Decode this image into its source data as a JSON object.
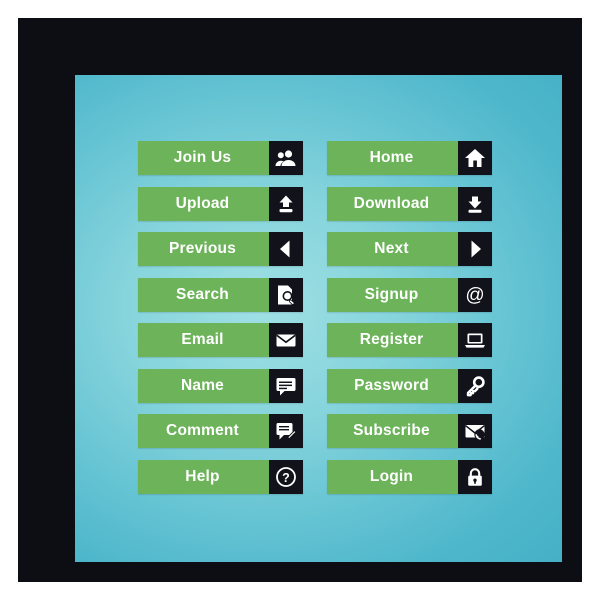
{
  "theme": {
    "frame_color": "#0c0e14",
    "panel_gradient_center": "#9fe0e4",
    "panel_gradient_edge": "#45b0c6",
    "button_green": "#6cb35a",
    "icon_block_dark": "#12131a",
    "label_text_color": "#ffffff"
  },
  "buttons": {
    "left_column": [
      {
        "label": "Join Us",
        "icon": "user-group-icon"
      },
      {
        "label": "Upload",
        "icon": "upload-arrow-icon"
      },
      {
        "label": "Previous",
        "icon": "arrow-left-icon"
      },
      {
        "label": "Search",
        "icon": "magnifier-document-icon"
      },
      {
        "label": "Email",
        "icon": "envelope-icon"
      },
      {
        "label": "Name",
        "icon": "speech-bubble-icon"
      },
      {
        "label": "Comment",
        "icon": "comment-pencil-icon"
      },
      {
        "label": "Help",
        "icon": "question-mark-icon"
      }
    ],
    "right_column": [
      {
        "label": "Home",
        "icon": "house-icon"
      },
      {
        "label": "Download",
        "icon": "download-arrow-icon"
      },
      {
        "label": "Next",
        "icon": "arrow-right-icon"
      },
      {
        "label": "Signup",
        "icon": "at-sign-icon"
      },
      {
        "label": "Register",
        "icon": "laptop-icon"
      },
      {
        "label": "Password",
        "icon": "key-icon"
      },
      {
        "label": "Subscribe",
        "icon": "envelope-rss-icon"
      },
      {
        "label": "Login",
        "icon": "padlock-icon"
      }
    ]
  }
}
